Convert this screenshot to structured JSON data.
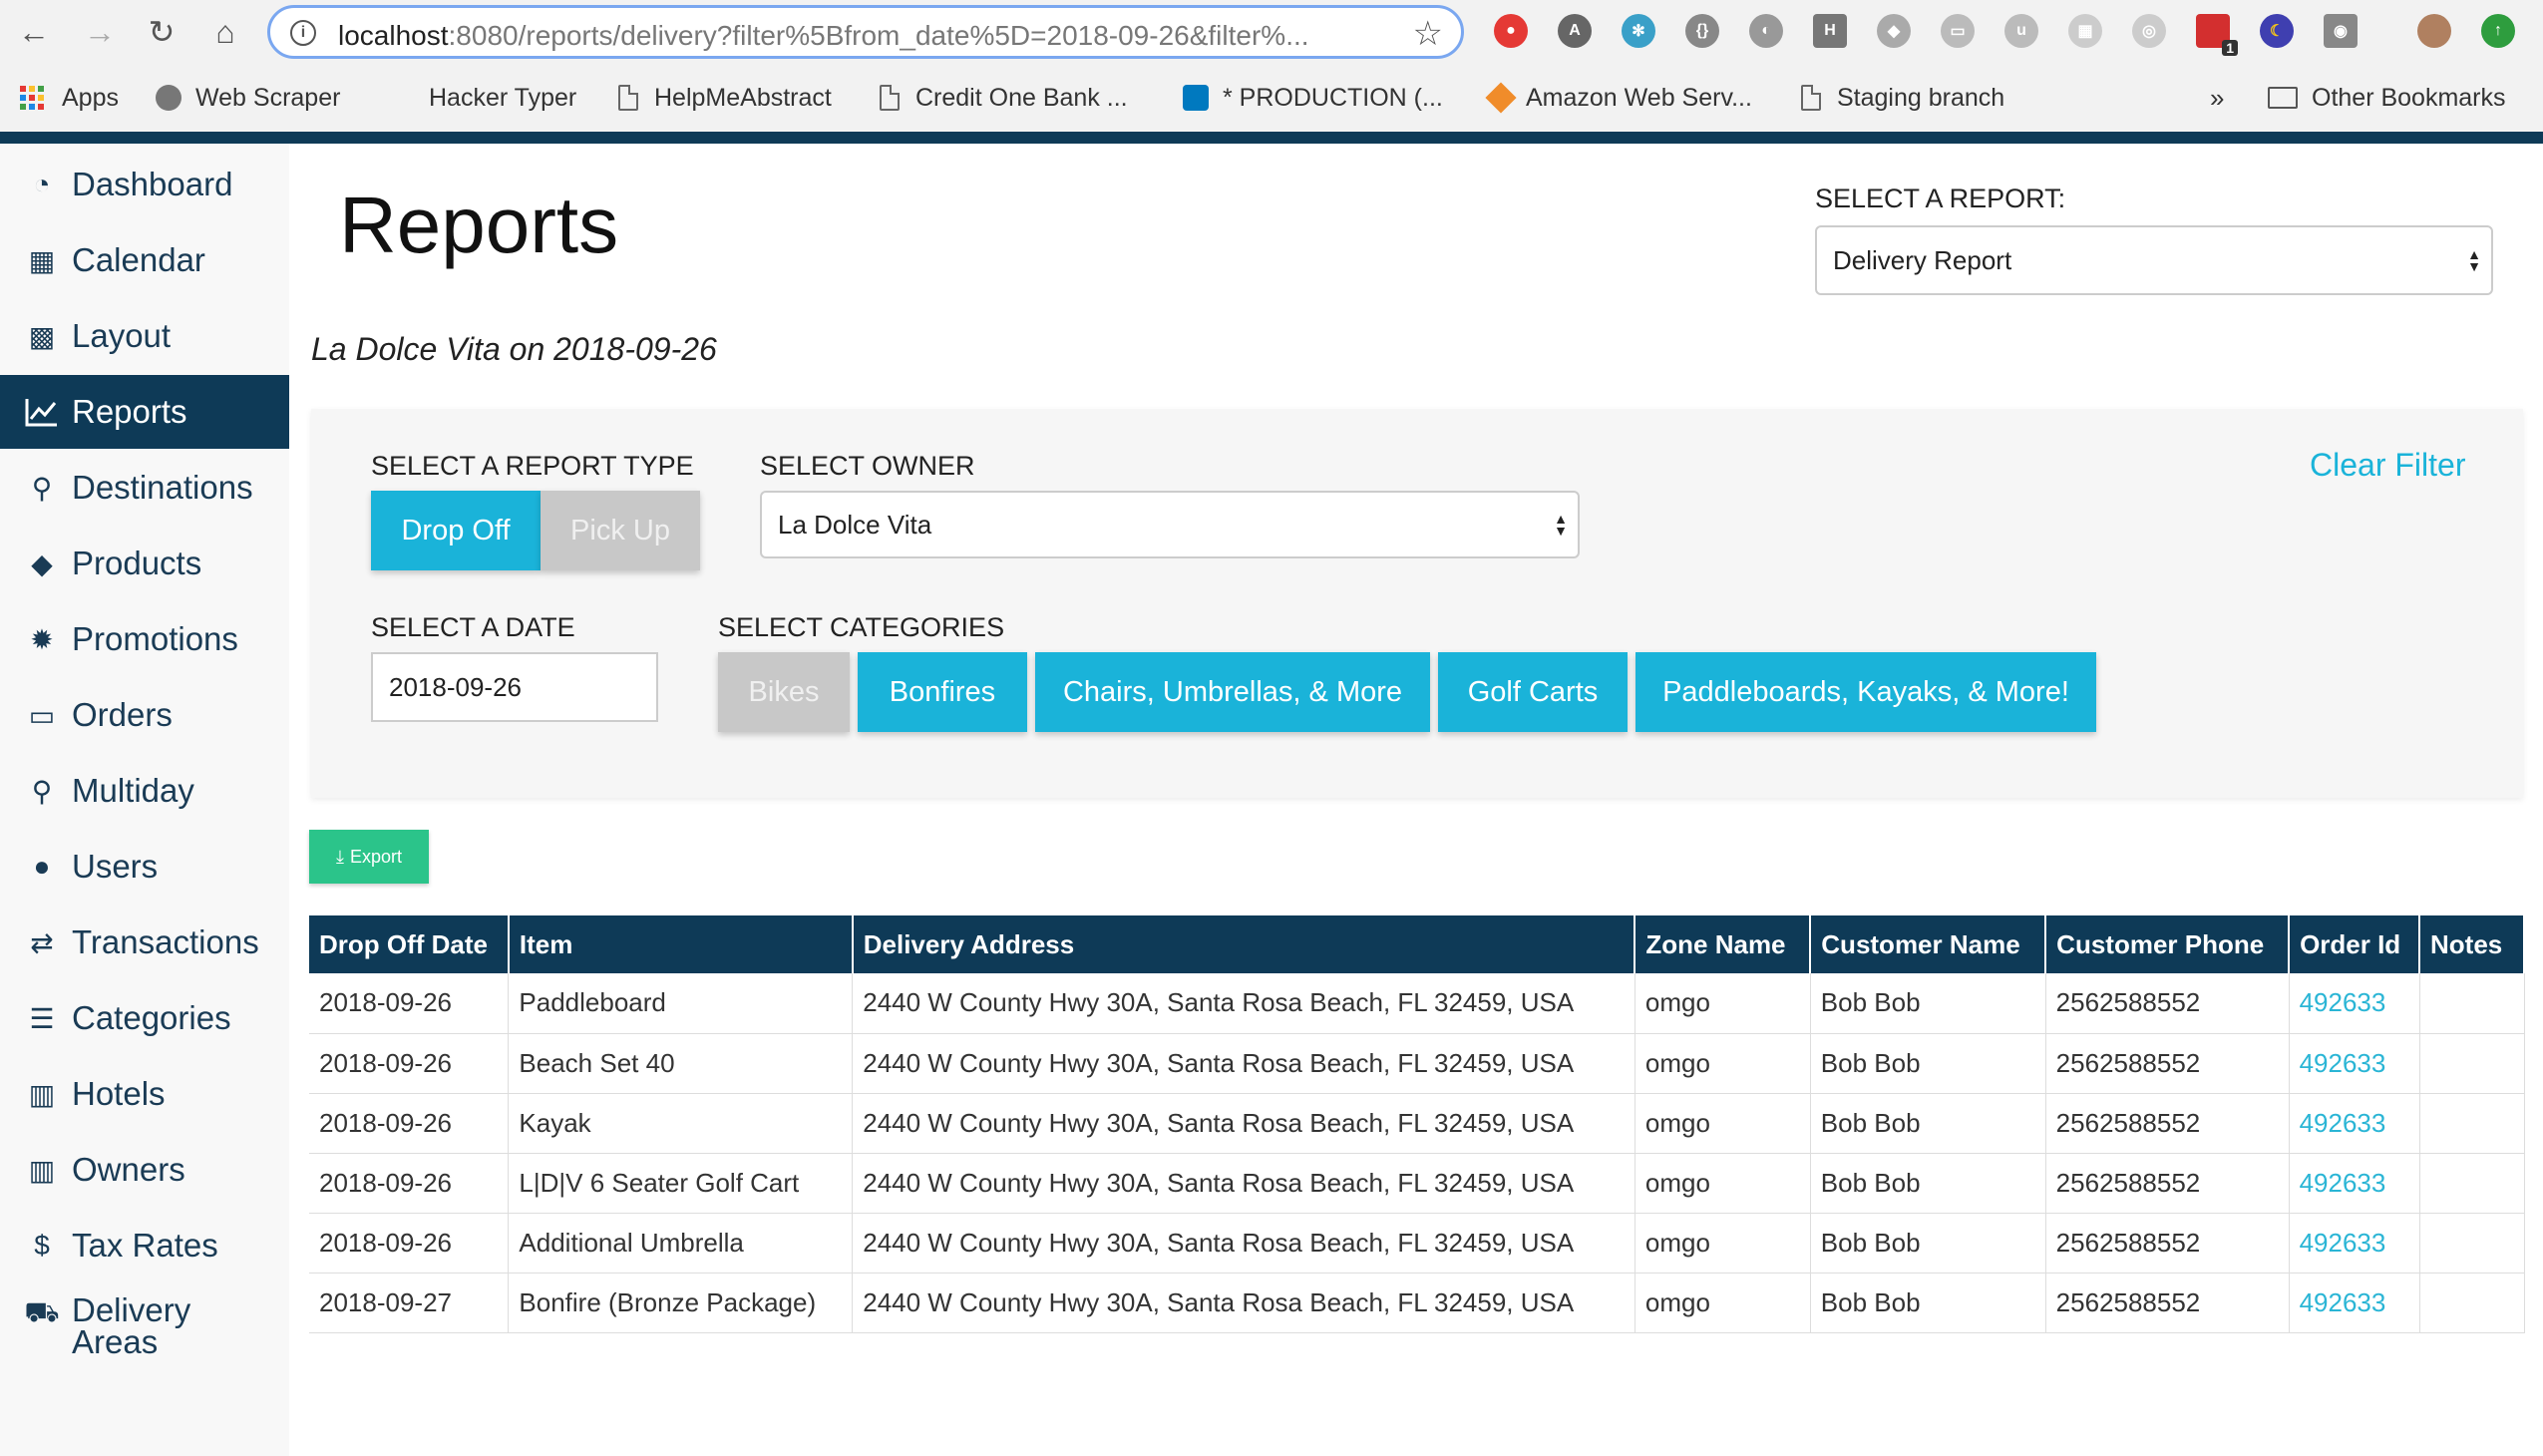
{
  "browser": {
    "url_host": "localhost",
    "url_path": ":8080/reports/delivery?filter%5Bfrom_date%5D=2018-09-26&filter%...",
    "bookmarks": [
      "Apps",
      "Web Scraper",
      "Hacker Typer",
      "HelpMeAbstract",
      "Credit One Bank ...",
      "* PRODUCTION (...",
      "Amazon Web Serv...",
      "Staging branch",
      "Other Bookmarks"
    ],
    "overflow": "»",
    "ext_badge": "1"
  },
  "sidebar": {
    "items": [
      {
        "label": "Dashboard",
        "icon": "dashboard-icon"
      },
      {
        "label": "Calendar",
        "icon": "calendar-icon"
      },
      {
        "label": "Layout",
        "icon": "grid-icon"
      },
      {
        "label": "Reports",
        "icon": "line-chart-icon"
      },
      {
        "label": "Destinations",
        "icon": "map-marker-icon"
      },
      {
        "label": "Products",
        "icon": "tag-icon"
      },
      {
        "label": "Promotions",
        "icon": "badge-icon"
      },
      {
        "label": "Orders",
        "icon": "credit-card-icon"
      },
      {
        "label": "Multiday",
        "icon": "search-icon"
      },
      {
        "label": "Users",
        "icon": "user-icon"
      },
      {
        "label": "Transactions",
        "icon": "exchange-icon"
      },
      {
        "label": "Categories",
        "icon": "list-icon"
      },
      {
        "label": "Hotels",
        "icon": "building-icon"
      },
      {
        "label": "Owners",
        "icon": "building-icon"
      },
      {
        "label": "Tax Rates",
        "icon": "dollar-icon"
      },
      {
        "label_line1": "Delivery",
        "label_line2": "Areas",
        "icon": "truck-icon"
      }
    ],
    "active": "Reports"
  },
  "header": {
    "title": "Reports",
    "subtitle": "La Dolce Vita on 2018-09-26",
    "select_report_label": "SELECT A REPORT:",
    "select_report_value": "Delivery Report"
  },
  "filters": {
    "report_type_label": "SELECT A REPORT TYPE",
    "drop_off": "Drop Off",
    "pick_up": "Pick Up",
    "owner_label": "SELECT OWNER",
    "owner_value": "La Dolce Vita",
    "clear_filter": "Clear Filter",
    "date_label": "SELECT A DATE",
    "date_value": "2018-09-26",
    "categories_label": "SELECT CATEGORIES",
    "categories": [
      "Bikes",
      "Bonfires",
      "Chairs, Umbrellas, & More",
      "Golf Carts",
      "Paddleboards, Kayaks, & More!"
    ]
  },
  "export_label": "Export",
  "table": {
    "headers": [
      "Drop Off Date",
      "Item",
      "Delivery Address",
      "Zone Name",
      "Customer Name",
      "Customer Phone",
      "Order Id",
      "Notes"
    ],
    "rows": [
      [
        "2018-09-26",
        "Paddleboard",
        "2440 W County Hwy 30A, Santa Rosa Beach, FL 32459, USA",
        "omgo",
        "Bob Bob",
        "2562588552",
        "492633",
        ""
      ],
      [
        "2018-09-26",
        "Beach Set 40",
        "2440 W County Hwy 30A, Santa Rosa Beach, FL 32459, USA",
        "omgo",
        "Bob Bob",
        "2562588552",
        "492633",
        ""
      ],
      [
        "2018-09-26",
        "Kayak",
        "2440 W County Hwy 30A, Santa Rosa Beach, FL 32459, USA",
        "omgo",
        "Bob Bob",
        "2562588552",
        "492633",
        ""
      ],
      [
        "2018-09-26",
        "L|D|V 6 Seater Golf Cart",
        "2440 W County Hwy 30A, Santa Rosa Beach, FL 32459, USA",
        "omgo",
        "Bob Bob",
        "2562588552",
        "492633",
        ""
      ],
      [
        "2018-09-26",
        "Additional Umbrella",
        "2440 W County Hwy 30A, Santa Rosa Beach, FL 32459, USA",
        "omgo",
        "Bob Bob",
        "2562588552",
        "492633",
        ""
      ],
      [
        "2018-09-27",
        "Bonfire (Bronze Package)",
        "2440 W County Hwy 30A, Santa Rosa Beach, FL 32459, USA",
        "omgo",
        "Bob Bob",
        "2562588552",
        "492633",
        ""
      ]
    ]
  },
  "colors": {
    "navy": "#0e3a57",
    "cyan": "#1ab3d9",
    "green": "#2bc48a",
    "grey_button": "#c8c8c8"
  }
}
